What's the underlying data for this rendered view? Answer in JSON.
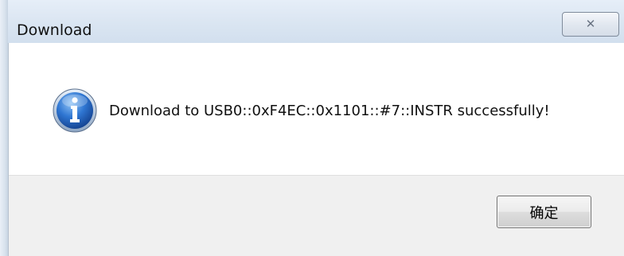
{
  "window": {
    "title": "Download",
    "close_glyph": "✕"
  },
  "dialog": {
    "icon": "info-icon",
    "message": "Download to USB0::0xF4EC::0x1101::#7::INSTR successfully!",
    "ok_label": "确定"
  },
  "colors": {
    "titlebar": "#dbe6f2",
    "footer": "#f0f0f0",
    "icon_blue": "#1f5fb8"
  }
}
